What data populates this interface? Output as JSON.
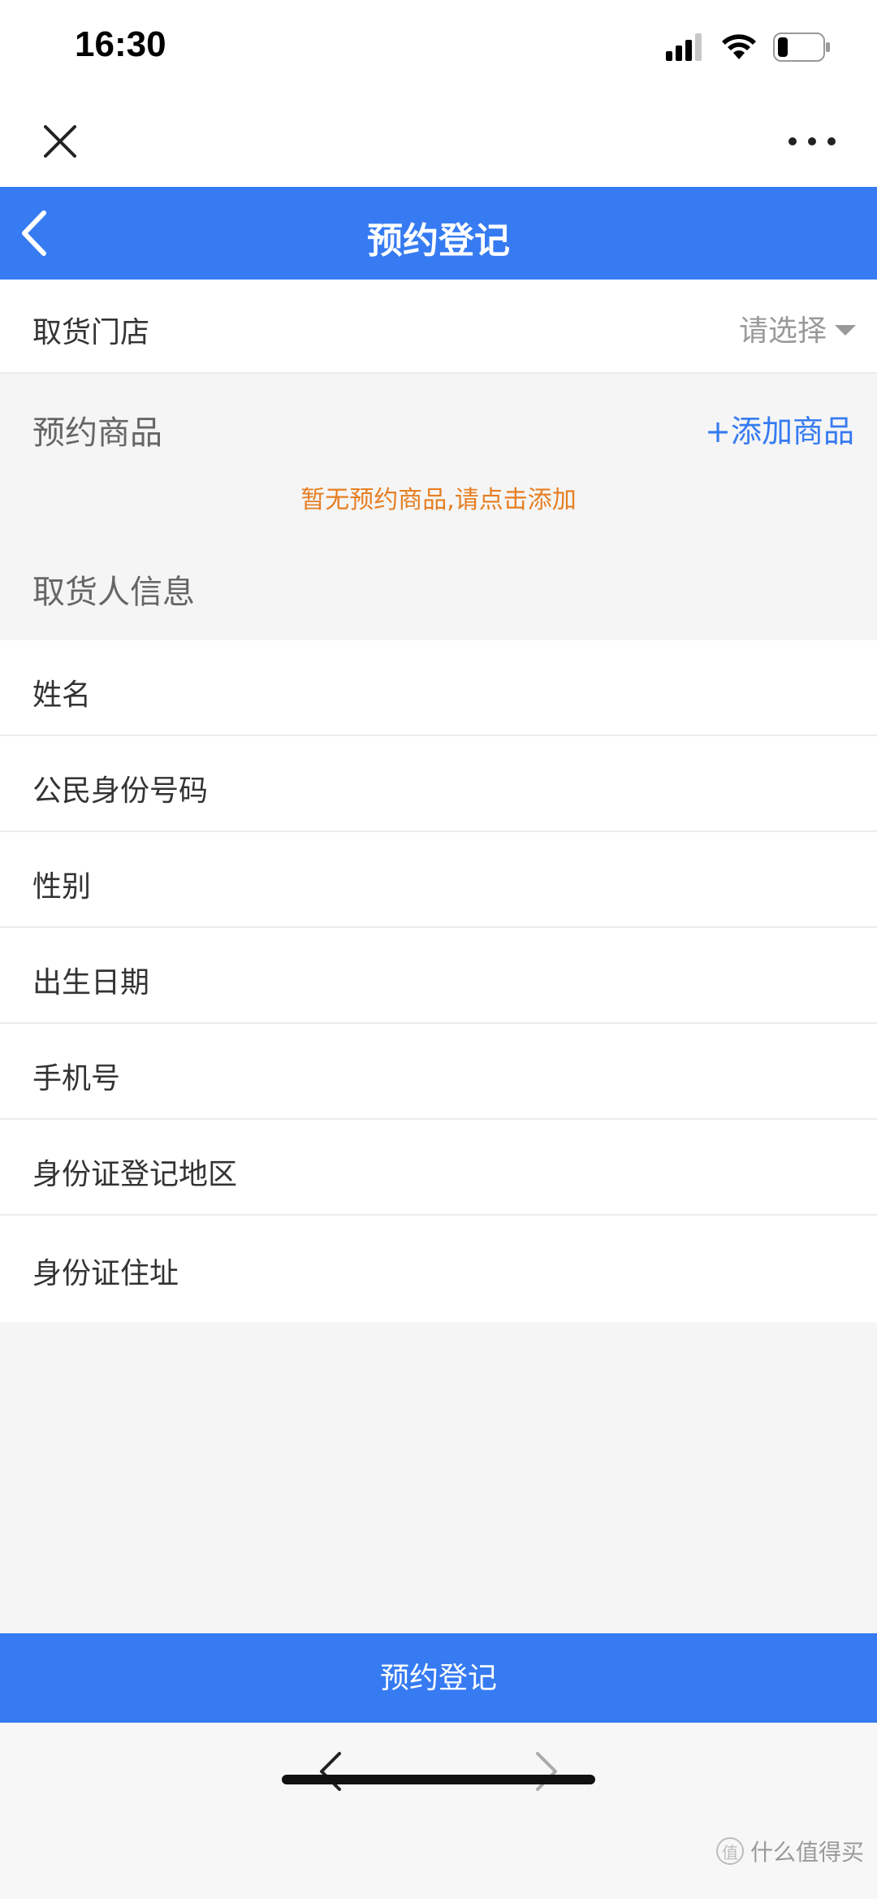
{
  "status_bar": {
    "time": "16:30"
  },
  "header": {
    "title": "预约登记"
  },
  "store": {
    "label": "取货门店",
    "select_placeholder": "请选择"
  },
  "goods": {
    "title": "预约商品",
    "add_label": "+添加商品",
    "empty_hint": "暂无预约商品,请点击添加"
  },
  "pickup": {
    "title": "取货人信息",
    "fields": [
      {
        "label": "姓名"
      },
      {
        "label": "公民身份号码"
      },
      {
        "label": "性别"
      },
      {
        "label": "出生日期"
      },
      {
        "label": "手机号"
      },
      {
        "label": "身份证登记地区"
      },
      {
        "label": "身份证住址"
      }
    ]
  },
  "submit": {
    "label": "预约登记"
  },
  "watermark": {
    "text": "什么值得买"
  },
  "colors": {
    "accent": "#367bf2",
    "hint": "#e67e22",
    "background": "#f5f5f5"
  },
  "icons": {
    "close": "close-icon",
    "more": "more-icon",
    "back": "chevron-left-icon",
    "nav_back": "arrow-left-icon",
    "nav_forward": "arrow-right-icon"
  }
}
